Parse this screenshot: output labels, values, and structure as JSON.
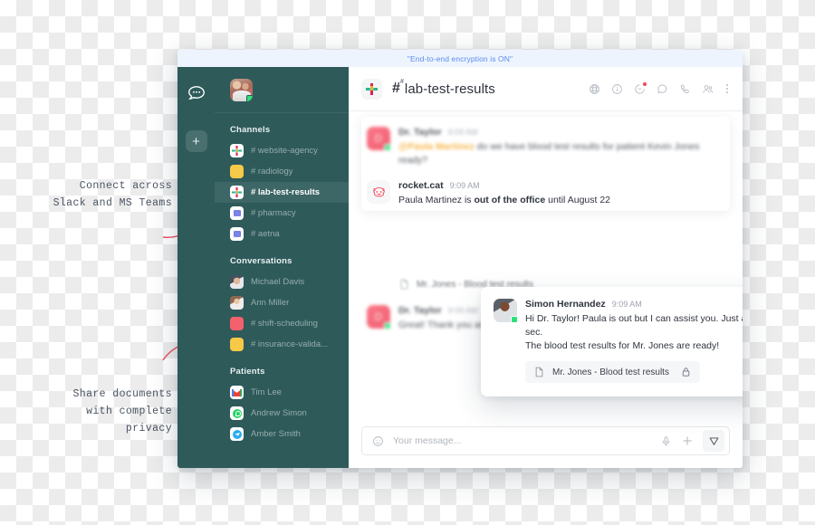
{
  "annotations": [
    {
      "id": "connect",
      "text": "Connect across\nSlack and MS Teams"
    },
    {
      "id": "share",
      "text": "Share documents\nwith complete\nprivacy"
    }
  ],
  "window": {
    "encryption_banner": "\"End-to-end encryption is ON\""
  },
  "left_rail": {
    "logo_name": "rocketchat-logo",
    "add_label": "+"
  },
  "sidebar": {
    "workspace_avatar_name": "workspace-avatar",
    "sections": [
      {
        "title": "Channels",
        "items": [
          {
            "label": "# website-agency",
            "icon": "slack-icon",
            "active": false
          },
          {
            "label": "# radiology",
            "icon": "yellow-square-icon",
            "active": false
          },
          {
            "label": "# lab-test-results",
            "icon": "slack-icon",
            "active": true
          },
          {
            "label": "# pharmacy",
            "icon": "msteams-icon",
            "active": false
          },
          {
            "label": "# aetna",
            "icon": "msteams-icon",
            "active": false
          }
        ]
      },
      {
        "title": "Conversations",
        "items": [
          {
            "label": "Michael Davis",
            "icon": "avatar-michael-icon",
            "active": false
          },
          {
            "label": "Ann Miller",
            "icon": "avatar-ann-icon",
            "active": false
          },
          {
            "label": "#  shift-scheduling",
            "icon": "pink-square-icon",
            "active": false
          },
          {
            "label": "#  insurance-valida...",
            "icon": "yellow-square-icon",
            "active": false
          }
        ]
      },
      {
        "title": "Patients",
        "items": [
          {
            "label": "Tim Lee",
            "icon": "gmail-icon",
            "active": false
          },
          {
            "label": "Andrew Simon",
            "icon": "whatsapp-icon",
            "active": false
          },
          {
            "label": "Amber Smith",
            "icon": "telegram-icon",
            "active": false
          }
        ]
      }
    ]
  },
  "chat": {
    "channel_hash": "#",
    "channel_name": "lab-test-results",
    "channel_app_icon": "slack-icon",
    "header_actions": [
      {
        "name": "globe-icon"
      },
      {
        "name": "info-icon"
      },
      {
        "name": "discussion-icon",
        "badge": true
      },
      {
        "name": "threads-icon"
      },
      {
        "name": "phone-icon"
      },
      {
        "name": "team-icon"
      },
      {
        "name": "kebab-menu-icon"
      }
    ],
    "messages": [
      {
        "author": "Dr. Taylor",
        "time": "9:09 AM",
        "avatar": "avatar-dr-taylor",
        "mention": "@Paula Martinez",
        "text": " do we have blood test results for patient Kevin Jones ready?",
        "blurred": true
      },
      {
        "author": "rocket.cat",
        "time": "9:09 AM",
        "avatar": "avatar-rocket-cat",
        "text_pre": "Paula Martinez is ",
        "text_bold": "out of the office",
        "text_post": " until August 22",
        "blurred": false
      },
      {
        "author": "Dr. Taylor",
        "time": "9:09 AM",
        "avatar": "avatar-dr-taylor",
        "text": "Great! Thank you and have a great rest of the day!",
        "blurred": true
      }
    ],
    "background_attachment_label": "Mr. Jones - Blood test results"
  },
  "popup": {
    "author": "Simon Hernandez",
    "time": "9:09 AM",
    "avatar": "avatar-simon-hernandez",
    "line1": "Hi Dr. Taylor! Paula is out but I can assist you. Just a sec.",
    "line2": "The blood test results for Mr. Jones are ready!",
    "attachment_label": "Mr. Jones - Blood test results",
    "attachment_doc_icon": "document-icon",
    "attachment_lock_icon": "lock-icon"
  },
  "composer": {
    "placeholder": "Your message...",
    "value": "",
    "emoji_icon": "emoji-icon",
    "audio_icon": "microphone-icon",
    "plus_icon": "plus-icon",
    "send_icon": "send-icon"
  },
  "colors": {
    "sidebar": "#2e5a5a",
    "accent_blue": "#5b8def",
    "banner_bg": "#eef4fe",
    "mention": "#f5a623",
    "badge": "#f5455c",
    "arrow": "#ef4b63"
  }
}
